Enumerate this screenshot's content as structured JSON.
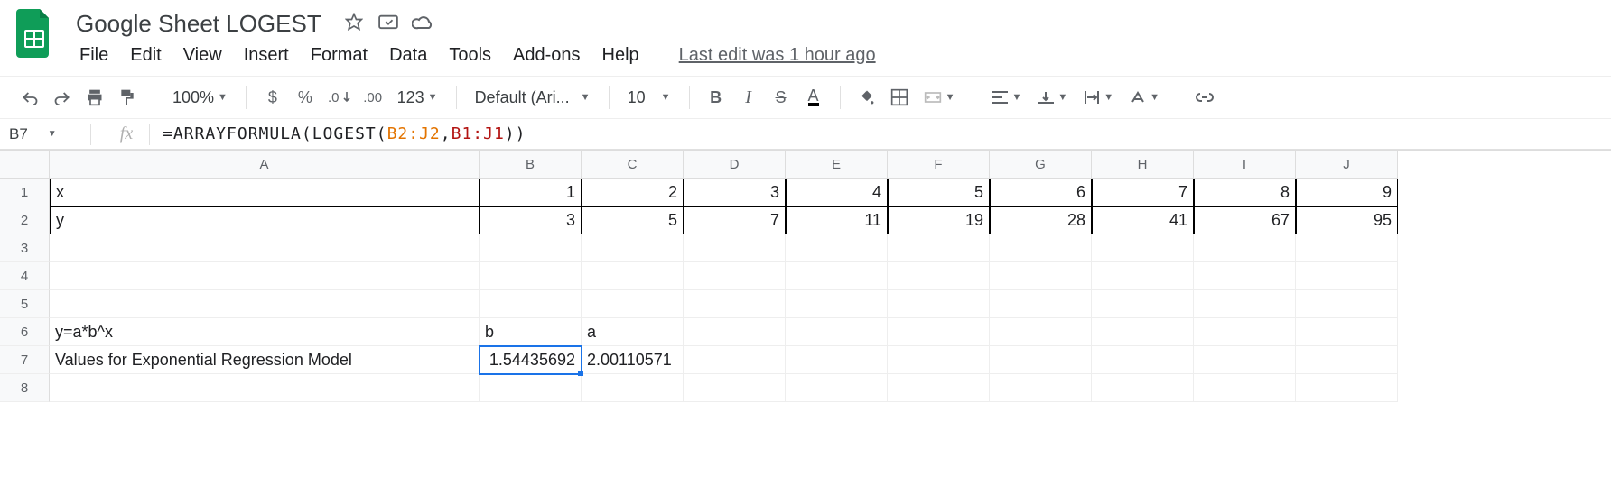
{
  "doc_title": "Google Sheet LOGEST",
  "menu": {
    "file": "File",
    "edit": "Edit",
    "view": "View",
    "insert": "Insert",
    "format": "Format",
    "data": "Data",
    "tools": "Tools",
    "addons": "Add-ons",
    "help": "Help",
    "last_edit": "Last edit was 1 hour ago"
  },
  "toolbar": {
    "zoom": "100%",
    "currency": "$",
    "percent": "%",
    "dec_dec": ".0",
    "inc_dec": ".00",
    "num_format": "123",
    "font": "Default (Ari...",
    "font_size": "10",
    "bold": "B",
    "italic": "I",
    "strike": "S",
    "text_color": "A"
  },
  "formula_bar": {
    "cell_ref": "B7",
    "prefix": "=ARRAYFORMULA(LOGEST(",
    "range1": "B2:J2",
    "comma": ",",
    "range2": "B1:J1",
    "suffix": "))"
  },
  "columns": [
    "A",
    "B",
    "C",
    "D",
    "E",
    "F",
    "G",
    "H",
    "I",
    "J"
  ],
  "rows": {
    "1": {
      "A": "x",
      "B": "1",
      "C": "2",
      "D": "3",
      "E": "4",
      "F": "5",
      "G": "6",
      "H": "7",
      "I": "8",
      "J": "9"
    },
    "2": {
      "A": "y",
      "B": "3",
      "C": "5",
      "D": "7",
      "E": "11",
      "F": "19",
      "G": "28",
      "H": "41",
      "I": "67",
      "J": "95"
    },
    "6": {
      "A": "y=a*b^x",
      "B": "b",
      "C": "a"
    },
    "7": {
      "A": "Values for Exponential Regression Model",
      "B": "1.54435692",
      "C": "2.00110571"
    }
  },
  "chart_data": {
    "type": "table",
    "title": "LOGEST exponential regression source data and coefficients",
    "series": [
      {
        "name": "x",
        "values": [
          1,
          2,
          3,
          4,
          5,
          6,
          7,
          8,
          9
        ]
      },
      {
        "name": "y",
        "values": [
          3,
          5,
          7,
          11,
          19,
          28,
          41,
          67,
          95
        ]
      }
    ],
    "model": "y = a * b^x",
    "coefficients": {
      "b": 1.54435692,
      "a": 2.00110571
    }
  }
}
